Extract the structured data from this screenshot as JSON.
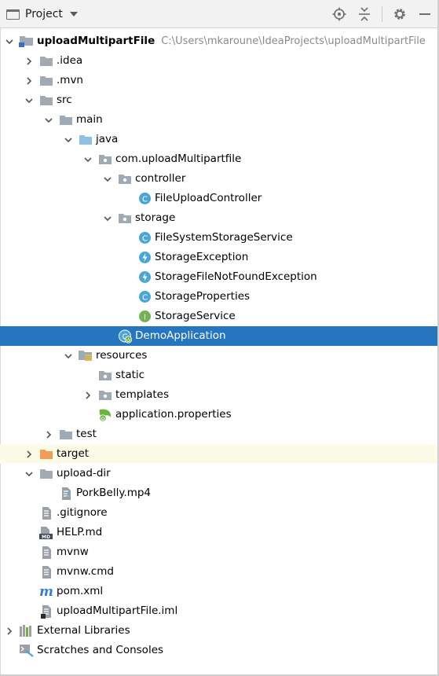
{
  "toolbar": {
    "title": "Project",
    "icons": [
      "window-icon",
      "dropdown-arrow-icon",
      "locate-icon",
      "collapse-all-icon",
      "gear-icon",
      "minimize-icon"
    ]
  },
  "colors": {
    "selection": "#2675bf",
    "folder": "#a0aab4",
    "source_folder": "#8fc1e6",
    "excluded_folder": "#f39c55",
    "class_badge": "#4aa6d6",
    "interface_badge": "#74b354",
    "exception_badge": "#4aa6d6"
  },
  "tree": [
    {
      "label": "uploadMultipartFile",
      "path": "C:\\Users\\mkaroune\\IdeaProjects\\uploadMultipartFile",
      "depth": 0,
      "expanded": true,
      "icon": "module-folder-icon",
      "bold": true
    },
    {
      "label": ".idea",
      "depth": 1,
      "expanded": false,
      "icon": "folder-icon"
    },
    {
      "label": ".mvn",
      "depth": 1,
      "expanded": false,
      "icon": "folder-icon"
    },
    {
      "label": "src",
      "depth": 1,
      "expanded": true,
      "icon": "folder-icon"
    },
    {
      "label": "main",
      "depth": 2,
      "expanded": true,
      "icon": "folder-icon"
    },
    {
      "label": "java",
      "depth": 3,
      "expanded": true,
      "icon": "source-folder-icon"
    },
    {
      "label": "com.uploadMultipartfile",
      "depth": 4,
      "expanded": true,
      "icon": "package-icon"
    },
    {
      "label": "controller",
      "depth": 5,
      "expanded": true,
      "icon": "package-icon"
    },
    {
      "label": "FileUploadController",
      "depth": 6,
      "icon": "class-icon"
    },
    {
      "label": "storage",
      "depth": 5,
      "expanded": true,
      "icon": "package-icon"
    },
    {
      "label": "FileSystemStorageService",
      "depth": 6,
      "icon": "class-icon"
    },
    {
      "label": "StorageException",
      "depth": 6,
      "icon": "exception-icon"
    },
    {
      "label": "StorageFileNotFoundException",
      "depth": 6,
      "icon": "exception-icon"
    },
    {
      "label": "StorageProperties",
      "depth": 6,
      "icon": "class-icon"
    },
    {
      "label": "StorageService",
      "depth": 6,
      "icon": "interface-icon"
    },
    {
      "label": "DemoApplication",
      "depth": 5,
      "icon": "spring-boot-class-icon",
      "selected": true
    },
    {
      "label": "resources",
      "depth": 3,
      "expanded": true,
      "icon": "resources-folder-icon"
    },
    {
      "label": "static",
      "depth": 4,
      "icon": "package-icon"
    },
    {
      "label": "templates",
      "depth": 4,
      "expanded": false,
      "icon": "package-icon"
    },
    {
      "label": "application.properties",
      "depth": 4,
      "icon": "spring-properties-icon"
    },
    {
      "label": "test",
      "depth": 2,
      "expanded": false,
      "icon": "folder-icon"
    },
    {
      "label": "target",
      "depth": 1,
      "expanded": false,
      "icon": "excluded-folder-icon",
      "excluded": true
    },
    {
      "label": "upload-dir",
      "depth": 1,
      "expanded": true,
      "icon": "folder-icon"
    },
    {
      "label": "PorkBelly.mp4",
      "depth": 2,
      "icon": "unknown-file-icon"
    },
    {
      "label": ".gitignore",
      "depth": 1,
      "icon": "text-file-icon"
    },
    {
      "label": "HELP.md",
      "depth": 1,
      "icon": "markdown-file-icon"
    },
    {
      "label": "mvnw",
      "depth": 1,
      "icon": "text-file-icon"
    },
    {
      "label": "mvnw.cmd",
      "depth": 1,
      "icon": "text-file-icon"
    },
    {
      "label": "pom.xml",
      "depth": 1,
      "icon": "maven-icon"
    },
    {
      "label": "uploadMultipartFile.iml",
      "depth": 1,
      "icon": "iml-file-icon"
    },
    {
      "label": "External Libraries",
      "depth": 0,
      "expanded": false,
      "icon": "libraries-icon"
    },
    {
      "label": "Scratches and Consoles",
      "depth": 0,
      "icon": "scratches-icon"
    }
  ]
}
